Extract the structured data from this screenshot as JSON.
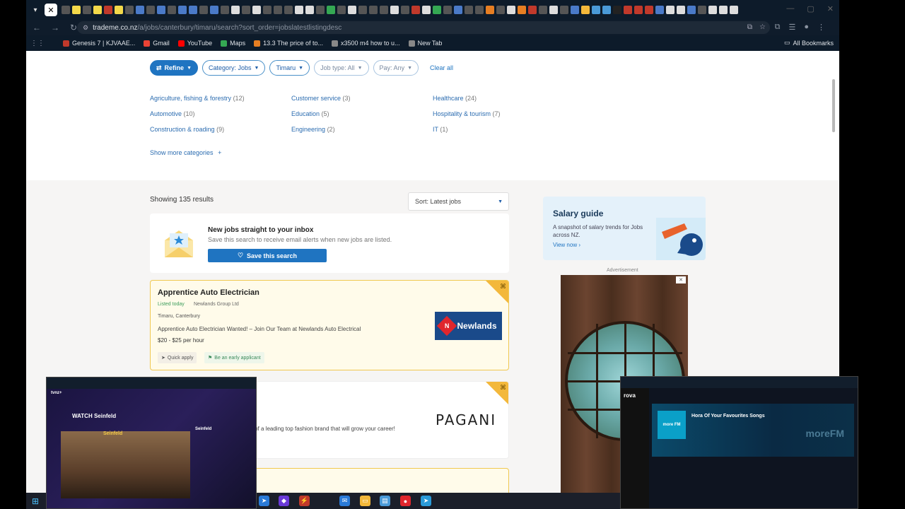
{
  "browser": {
    "url_host": "trademe.co.nz",
    "url_path": "/a/jobs/canterbury/timaru/search?sort_order=jobslatestlistingdesc",
    "bookmarks": [
      {
        "label": "Genesis 7 | KJVAAE...",
        "color": "#c0392b"
      },
      {
        "label": "Gmail",
        "color": "#ea4335"
      },
      {
        "label": "YouTube",
        "color": "#ff0000"
      },
      {
        "label": "Maps",
        "color": "#34a853"
      },
      {
        "label": "13.3 The price of to...",
        "color": "#e67e22"
      },
      {
        "label": "x3500 m4 how to u...",
        "color": "#888888"
      },
      {
        "label": "New Tab",
        "color": "#888888"
      }
    ],
    "all_bookmarks": "All Bookmarks"
  },
  "filters": {
    "refine": "Refine",
    "category": "Category: Jobs",
    "location": "Timaru",
    "job_type": "Job type: All",
    "pay": "Pay: Any",
    "clear": "Clear all"
  },
  "categories": [
    {
      "name": "Agriculture, fishing & forestry",
      "count": "(12)"
    },
    {
      "name": "Customer service",
      "count": "(3)"
    },
    {
      "name": "Healthcare",
      "count": "(24)"
    },
    {
      "name": "Automotive",
      "count": "(10)"
    },
    {
      "name": "Education",
      "count": "(5)"
    },
    {
      "name": "Hospitality & tourism",
      "count": "(7)"
    },
    {
      "name": "Construction & roading",
      "count": "(9)"
    },
    {
      "name": "Engineering",
      "count": "(2)"
    },
    {
      "name": "IT",
      "count": "(1)"
    }
  ],
  "show_more": "Show more categories",
  "results": {
    "showing": "Showing 135 results",
    "sort": "Sort: Latest jobs"
  },
  "alert": {
    "title": "New jobs straight to your inbox",
    "subtitle": "Save this search to receive email alerts when new jobs are listed.",
    "button": "Save this search"
  },
  "jobs": [
    {
      "title": "Apprentice Auto Electrician",
      "listed": "Listed today",
      "company": "Newlands Group Ltd",
      "location": "Timaru, Canterbury",
      "description": "Apprentice Auto Electrician Wanted! – Join Our Team at Newlands Auto Electrical",
      "pay": "$20 - $25 per hour",
      "tag_quick": "Quick apply",
      "tag_early": "Be an early applicant",
      "logo_text": "Newlands"
    },
    {
      "description": "rt of a leading top fashion brand that will grow your career!",
      "logo_text": "PAGANI"
    }
  ],
  "salary_guide": {
    "title": "Salary guide",
    "subtitle": "A snapshot of salary trends for Jobs across NZ.",
    "link": "View now"
  },
  "ad_label": "Advertisement",
  "thumbnails": {
    "left_title": "WATCH Seinfeld",
    "left_brand": "tvnz+",
    "left_show": "Seinfeld",
    "right_logo": "rova",
    "right_song": "Hora Of Your Favourites Songs",
    "right_brand": "moreFM",
    "right_art": "more FM"
  }
}
